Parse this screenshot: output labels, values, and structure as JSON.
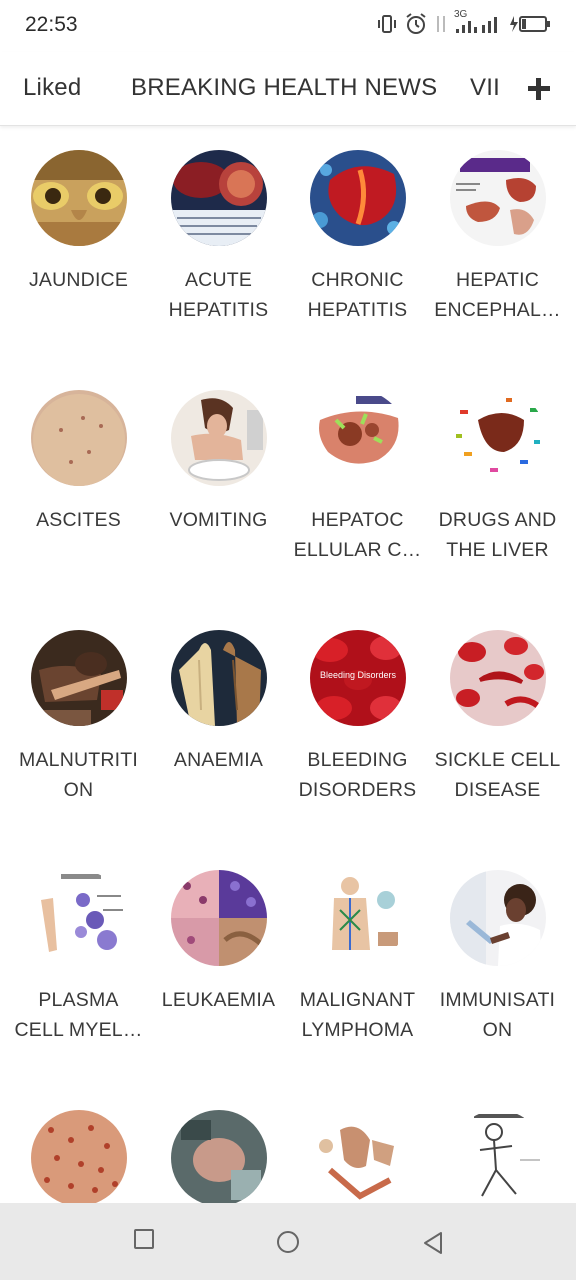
{
  "status": {
    "time": "22:53",
    "network": "3G"
  },
  "tabs": {
    "liked": "Liked",
    "breaking": "BREAKING HEALTH NEWS",
    "vii": "VII"
  },
  "items": [
    {
      "line1": "JAUNDICE",
      "line2": "",
      "icon": "jaundice-eyes-image"
    },
    {
      "line1": "ACUTE",
      "line2": "HEPATITIS",
      "icon": "acute-hepatitis-image"
    },
    {
      "line1": "CHRONIC",
      "line2": "HEPATITIS",
      "icon": "chronic-hepatitis-image"
    },
    {
      "line1": "HEPATIC",
      "line2": "ENCEPHAL…",
      "icon": "hepatic-encephalopathy-image"
    },
    {
      "line1": "ASCITES",
      "line2": "",
      "icon": "ascites-abdomen-image"
    },
    {
      "line1": "VOMITING",
      "line2": "",
      "icon": "vomiting-image"
    },
    {
      "line1": "HEPATOC",
      "line2": "ELLULAR C…",
      "icon": "hepatocellular-carcinoma-image"
    },
    {
      "line1": "DRUGS AND",
      "line2": "THE LIVER",
      "icon": "drugs-liver-image"
    },
    {
      "line1": "MALNUTRITI",
      "line2": "ON",
      "icon": "malnutrition-image"
    },
    {
      "line1": "ANAEMIA",
      "line2": "",
      "icon": "anaemia-hands-image"
    },
    {
      "line1": "BLEEDING",
      "line2": "DISORDERS",
      "icon": "bleeding-disorders-image",
      "overlay": "Bleeding Disorders"
    },
    {
      "line1": "SICKLE CELL",
      "line2": "DISEASE",
      "icon": "sickle-cell-image"
    },
    {
      "line1": "PLASMA",
      "line2": "CELL MYEL…",
      "icon": "plasma-cell-myeloma-image"
    },
    {
      "line1": "LEUKAEMIA",
      "line2": "",
      "icon": "leukaemia-image"
    },
    {
      "line1": "MALIGNANT",
      "line2": "LYMPHOMA",
      "icon": "malignant-lymphoma-image"
    },
    {
      "line1": "IMMUNISATI",
      "line2": "ON",
      "icon": "immunisation-image"
    },
    {
      "line1": "",
      "line2": "",
      "icon": "measles-rash-image"
    },
    {
      "line1": "",
      "line2": "",
      "icon": "newborn-image"
    },
    {
      "line1": "",
      "line2": "",
      "icon": "anatomy-diagram-image"
    },
    {
      "line1": "",
      "line2": "",
      "icon": "sketch-figure-image"
    }
  ],
  "colors": {
    "text": "#3a3a3a",
    "nav_bar": "#e9e9e9"
  }
}
